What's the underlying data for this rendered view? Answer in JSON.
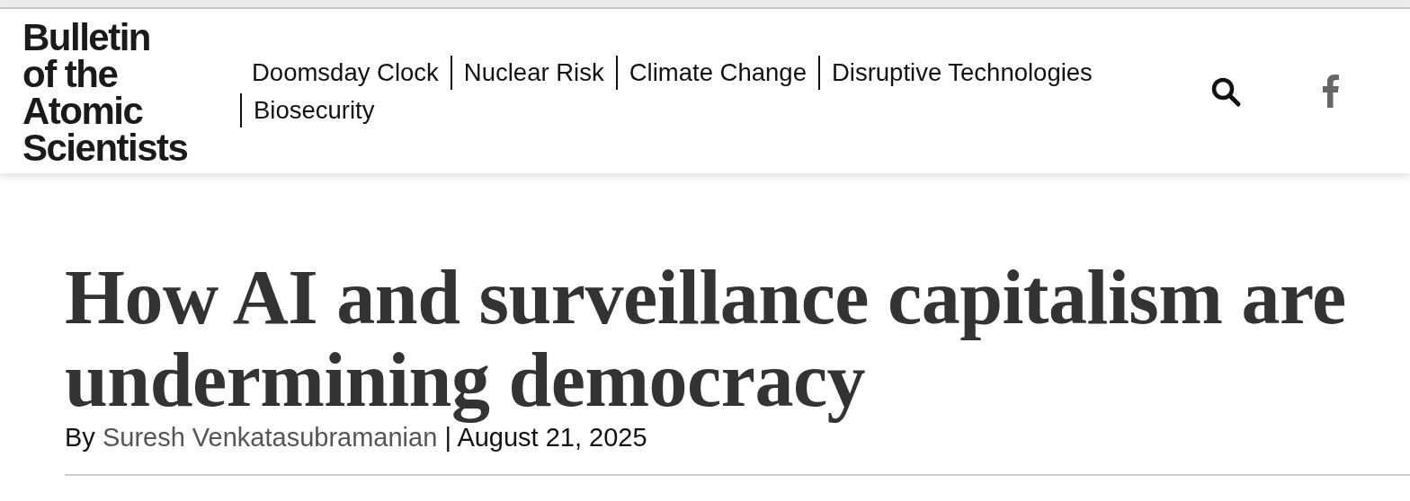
{
  "logo": {
    "lines": [
      "Bulletin",
      "of the",
      "Atomic",
      "Scientists"
    ]
  },
  "nav": {
    "items": [
      {
        "label": "Doomsday Clock"
      },
      {
        "label": "Nuclear Risk"
      },
      {
        "label": "Climate Change"
      },
      {
        "label": "Disruptive Technologies"
      },
      {
        "label": "Biosecurity"
      }
    ]
  },
  "article": {
    "title": "How AI and surveillance capitalism are undermining democracy",
    "byline_prefix": "By",
    "author": "Suresh Venkatasubramanian",
    "date_separator": "|",
    "date": "August 21, 2025"
  }
}
